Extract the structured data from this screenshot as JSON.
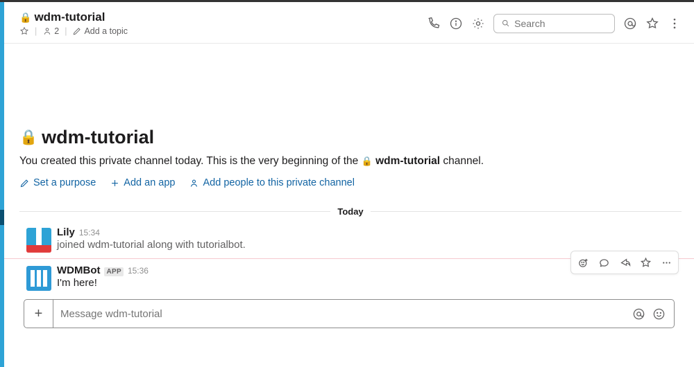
{
  "header": {
    "channel_name": "wdm-tutorial",
    "member_count": "2",
    "add_topic_label": "Add a topic",
    "search_placeholder": "Search"
  },
  "intro": {
    "title": "wdm-tutorial",
    "desc_prefix": "You created this private channel today. This is the very beginning of the ",
    "desc_bold": "wdm-tutorial",
    "desc_suffix": " channel.",
    "links": {
      "set_purpose": "Set a purpose",
      "add_app": "Add an app",
      "add_people": "Add people to this private channel"
    }
  },
  "divider_label": "Today",
  "messages": [
    {
      "user": "Lily",
      "time": "15:34",
      "text": "joined wdm-tutorial along with tutorialbot.",
      "is_app": false
    },
    {
      "user": "WDMBot",
      "time": "15:36",
      "text": "I'm here!",
      "is_app": true,
      "app_badge": "APP"
    }
  ],
  "composer": {
    "placeholder": "Message wdm-tutorial"
  }
}
